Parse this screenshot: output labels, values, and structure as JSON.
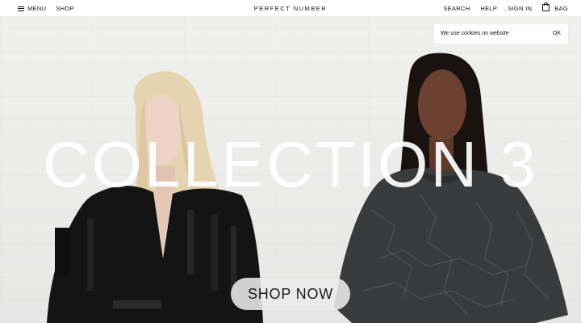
{
  "header": {
    "menu_label": "MENU",
    "shop_label": "SHOP",
    "brand": "PERFECT NUMBER",
    "search_label": "SEARCH",
    "help_label": "HELP",
    "signin_label": "SIGN IN",
    "bag_label": "BAG"
  },
  "cookie_banner": {
    "message": "We use cookies on website",
    "ok_label": "OK"
  },
  "hero": {
    "title": "COLLECTION 3",
    "cta_label": "SHOP NOW"
  },
  "colors": {
    "wall": "#ebebea",
    "garment_black": "#141414",
    "garment_gray": "#3a3b3d",
    "skin_light": "#e9cfc0",
    "skin_dark": "#6b4232",
    "hair_blonde": "#e6d3b0",
    "hair_dark": "#1a120e"
  },
  "icons": {
    "menu": "hamburger-icon",
    "bag": "bag-icon"
  }
}
